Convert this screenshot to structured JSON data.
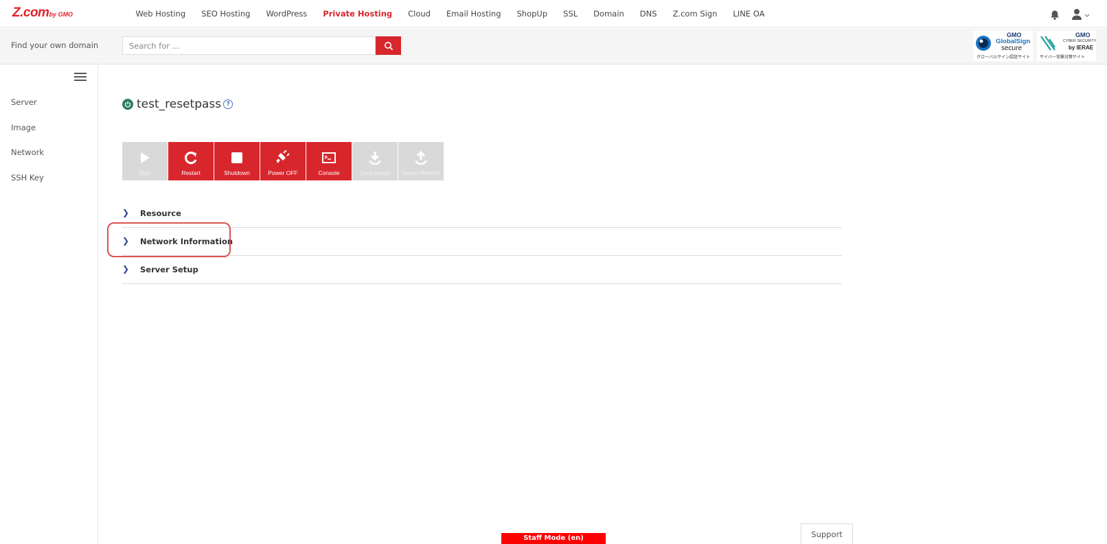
{
  "brand": {
    "logo_main": "Z.com",
    "logo_sub": "by GMO",
    "color": "#d8262d"
  },
  "nav": {
    "items": [
      "Web Hosting",
      "SEO Hosting",
      "WordPress",
      "Private Hosting",
      "Cloud",
      "Email Hosting",
      "ShopUp",
      "SSL",
      "Domain",
      "DNS",
      "Z.com Sign",
      "LINE OA"
    ],
    "active": "Private Hosting",
    "icons": [
      "bell-icon",
      "user-icon"
    ]
  },
  "search": {
    "label": "Find your own domain",
    "placeholder": "Search for ...",
    "button_icon": "search-icon"
  },
  "badges": {
    "globalsign": {
      "line1": "GMO",
      "line2": "GlobalSign",
      "line3": "secure",
      "line4": "グローバルサイン認証サイト"
    },
    "cybersecurity": {
      "line1": "GMO",
      "line2": "CYBER SECURITY",
      "line3": "by IERAE",
      "line4": "サイバー攻撃対策サイト"
    }
  },
  "sidebar": {
    "items": [
      "Server",
      "Image",
      "Network",
      "SSH Key"
    ]
  },
  "server": {
    "name": "test_resetpass",
    "status_icon": "power-icon",
    "status_color": "#2e7d6b"
  },
  "toolbar": {
    "buttons": [
      {
        "label": "Start",
        "icon": "play-icon",
        "enabled": false
      },
      {
        "label": "Restart",
        "icon": "restart-icon",
        "enabled": true
      },
      {
        "label": "Shutdown",
        "icon": "stop-icon",
        "enabled": true
      },
      {
        "label": "Power OFF",
        "icon": "plug-icon",
        "enabled": true
      },
      {
        "label": "Console",
        "icon": "console-icon",
        "enabled": true
      },
      {
        "label": "Save image",
        "icon": "download-icon",
        "enabled": false
      },
      {
        "label": "Server Rebuild",
        "icon": "upload-icon",
        "enabled": false
      }
    ]
  },
  "sections": [
    "Resource",
    "Network Information",
    "Server Setup"
  ],
  "highlighted_section": "Network Information",
  "footer": {
    "staff_mode": "Staff Mode (en)",
    "support": "Support"
  }
}
